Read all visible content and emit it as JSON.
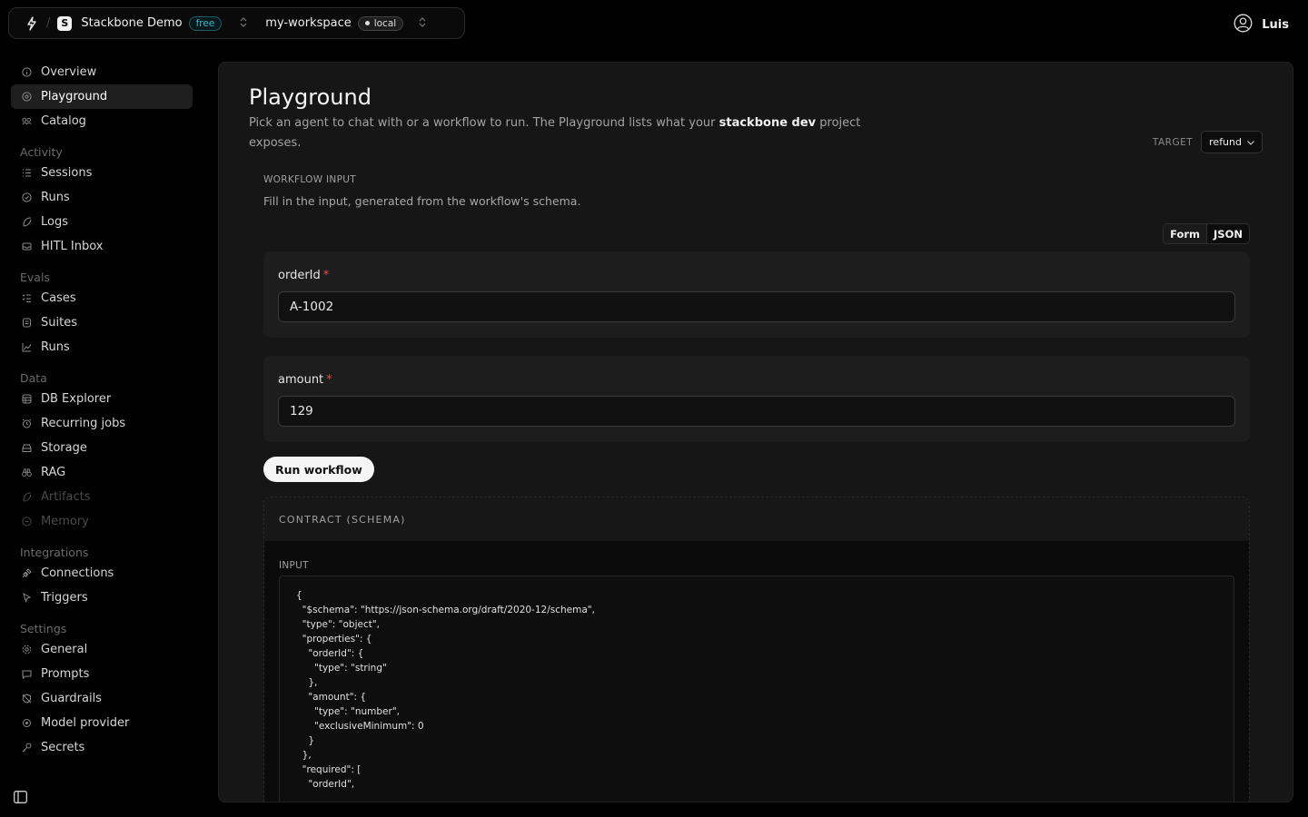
{
  "topbar": {
    "project_name": "Stackbone Demo",
    "project_initial": "S",
    "plan_badge": "free",
    "workspace_name": "my-workspace",
    "env_badge": "local",
    "user_name": "Luis"
  },
  "sidebar": {
    "top_items": [
      {
        "label": "Overview",
        "icon": "info-circle-icon"
      },
      {
        "label": "Playground",
        "icon": "play-circle-icon"
      },
      {
        "label": "Catalog",
        "icon": "catalog-icon"
      }
    ],
    "sections": [
      {
        "title": "Activity",
        "items": [
          {
            "label": "Sessions",
            "icon": "list-icon"
          },
          {
            "label": "Runs",
            "icon": "clock-icon"
          },
          {
            "label": "Logs",
            "icon": "logs-icon"
          },
          {
            "label": "HITL Inbox",
            "icon": "inbox-icon"
          }
        ]
      },
      {
        "title": "Evals",
        "items": [
          {
            "label": "Cases",
            "icon": "list-check-icon"
          },
          {
            "label": "Suites",
            "icon": "layers-icon"
          },
          {
            "label": "Runs",
            "icon": "chart-line-icon"
          }
        ]
      },
      {
        "title": "Data",
        "items": [
          {
            "label": "DB Explorer",
            "icon": "database-icon"
          },
          {
            "label": "Recurring jobs",
            "icon": "alarm-icon"
          },
          {
            "label": "Storage",
            "icon": "hard-drive-icon"
          },
          {
            "label": "RAG",
            "icon": "binoculars-icon"
          },
          {
            "label": "Artifacts",
            "icon": "artifact-icon",
            "disabled": true
          },
          {
            "label": "Memory",
            "icon": "memory-icon",
            "disabled": true
          }
        ]
      },
      {
        "title": "Integrations",
        "items": [
          {
            "label": "Connections",
            "icon": "plug-icon"
          },
          {
            "label": "Triggers",
            "icon": "pointer-icon"
          }
        ]
      },
      {
        "title": "Settings",
        "items": [
          {
            "label": "General",
            "icon": "gear-icon"
          },
          {
            "label": "Prompts",
            "icon": "message-icon"
          },
          {
            "label": "Guardrails",
            "icon": "shield-off-icon"
          },
          {
            "label": "Model provider",
            "icon": "model-icon"
          },
          {
            "label": "Secrets",
            "icon": "key-icon"
          }
        ]
      }
    ]
  },
  "main": {
    "title": "Playground",
    "desc_before": "Pick an agent to chat with or a workflow to run. The Playground lists what your ",
    "desc_project": "stackbone dev",
    "desc_after": " project exposes.",
    "target_label": "TARGET",
    "target_value": "refund",
    "workflow_input_label": "WORKFLOW INPUT",
    "workflow_input_hint": "Fill in the input, generated from the workflow's schema.",
    "mode_tabs": [
      "Form",
      "JSON"
    ],
    "fields": [
      {
        "label": "orderId",
        "required_mark": "*",
        "value": "A-1002"
      },
      {
        "label": "amount",
        "required_mark": "*",
        "value": "129"
      }
    ],
    "run_button": "Run workflow",
    "contract_title": "CONTRACT (SCHEMA)",
    "contract_input_label": "INPUT",
    "schema_text": "{\n  \"$schema\": \"https://json-schema.org/draft/2020-12/schema\",\n  \"type\": \"object\",\n  \"properties\": {\n    \"orderId\": {\n      \"type\": \"string\"\n    },\n    \"amount\": {\n      \"type\": \"number\",\n      \"exclusiveMinimum\": 0\n    }\n  },\n  \"required\": [\n    \"orderId\","
  }
}
